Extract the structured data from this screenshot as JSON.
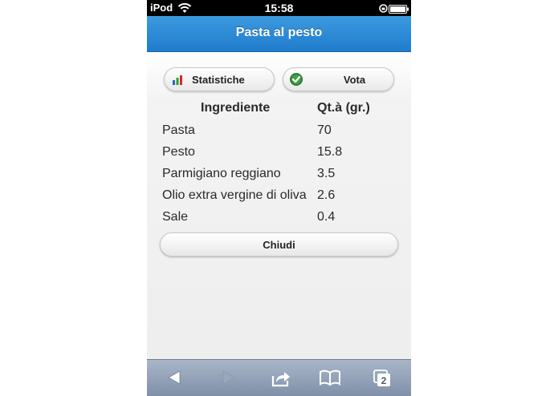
{
  "status_bar": {
    "carrier": "iPod",
    "time": "15:58",
    "wifi_icon": "wifi-icon",
    "lock_icon": "orientation-lock-icon",
    "battery_icon": "battery-icon"
  },
  "header": {
    "title": "Pasta al pesto"
  },
  "actions": {
    "stats_label": "Statistiche",
    "stats_icon": "bar-chart-icon",
    "vote_label": "Vota",
    "vote_icon": "checkmark-badge-icon"
  },
  "table": {
    "headers": [
      "Ingrediente",
      "Qt.à (gr.)"
    ],
    "rows": [
      {
        "name": "Pasta",
        "qty": "70"
      },
      {
        "name": "Pesto",
        "qty": "15.8"
      },
      {
        "name": "Parmigiano reggiano",
        "qty": "3.5"
      },
      {
        "name": "Olio extra vergine di oliva",
        "qty": "2.6"
      },
      {
        "name": "Sale",
        "qty": "0.4"
      }
    ]
  },
  "close_label": "Chiudi",
  "toolbar": {
    "icons": [
      "back-icon",
      "forward-icon",
      "share-icon",
      "bookmarks-icon",
      "tabs-icon"
    ],
    "tab_count": "2"
  },
  "colors": {
    "header_blue": "#1f7ccc",
    "toolbar": "#8a9ab0"
  }
}
